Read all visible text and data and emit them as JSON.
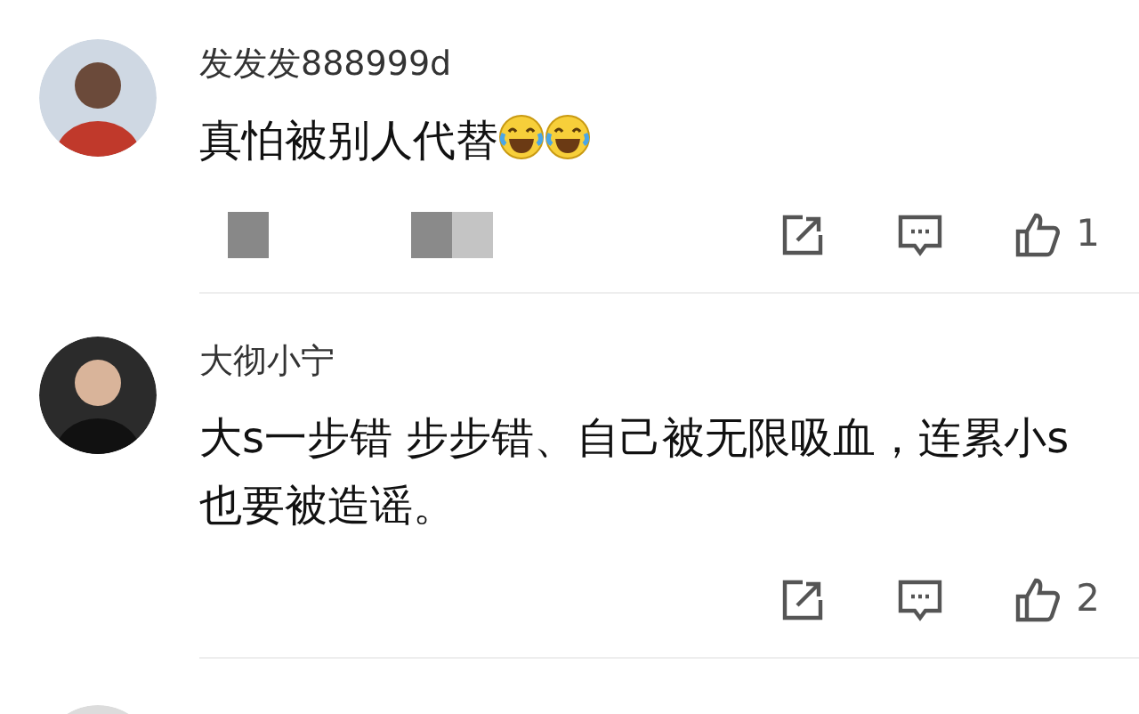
{
  "comments": [
    {
      "name": "发发发888999d",
      "text": "真怕被别人代替",
      "emojis": [
        {
          "kind": "laugh-cry"
        },
        {
          "kind": "laugh-cry"
        }
      ],
      "blurred": true,
      "likes": "1"
    },
    {
      "name": "大彻小宁",
      "text": "大s一步错 步步错、自己被无限吸血，连累小s也要被造谣。",
      "blurred": false,
      "likes": "2"
    }
  ]
}
